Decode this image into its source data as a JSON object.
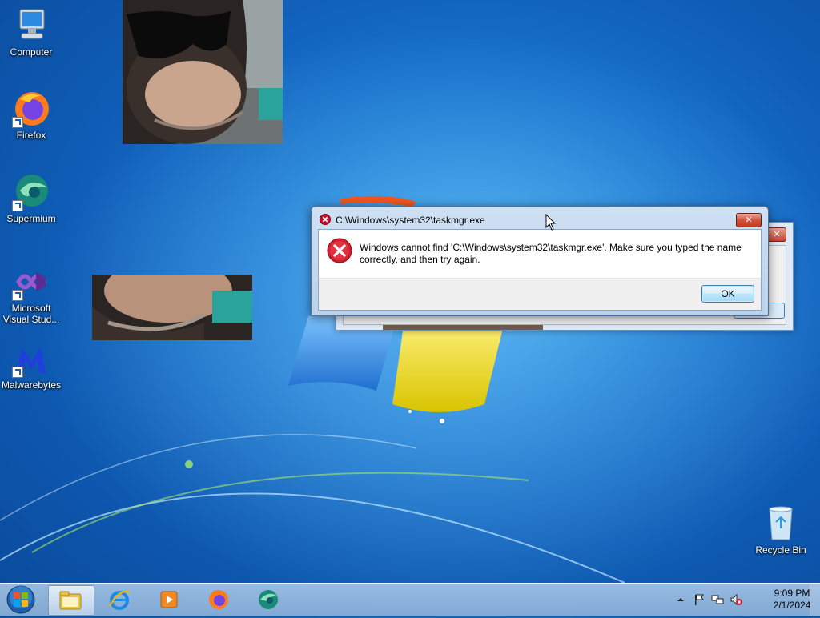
{
  "desktop": {
    "icons": [
      {
        "label": "Computer",
        "icon": "computer-icon"
      },
      {
        "label": "Firefox",
        "icon": "firefox-icon"
      },
      {
        "label": "Supermium",
        "icon": "supermium-icon"
      },
      {
        "label": "Microsoft Visual Stud...",
        "icon": "visual-studio-icon"
      },
      {
        "label": "Malwarebytes",
        "icon": "malwarebytes-icon"
      },
      {
        "label": "Recycle Bin",
        "icon": "recycle-bin-icon"
      }
    ],
    "images": [
      "chimp-photo",
      "chimp-photo-crop"
    ]
  },
  "dialog": {
    "title": "C:\\Windows\\system32\\taskmgr.exe",
    "message": "Windows cannot find 'C:\\Windows\\system32\\taskmgr.exe'. Make sure you typed the name correctly, and then try again.",
    "ok_label": "OK",
    "close_label": "✕",
    "icon": "error-icon"
  },
  "background_window": {
    "close_label": "✕"
  },
  "taskbar": {
    "start": "windows-start-orb",
    "pinned": [
      {
        "name": "explorer-icon",
        "active": true
      },
      {
        "name": "internet-explorer-icon",
        "active": false
      },
      {
        "name": "media-player-icon",
        "active": false
      },
      {
        "name": "firefox-icon",
        "active": false
      },
      {
        "name": "supermium-icon",
        "active": false
      }
    ],
    "tray": {
      "icons": [
        "show-hidden-icons",
        "action-center-flag-icon",
        "network-icon",
        "volume-muted-icon"
      ],
      "time": "9:09 PM",
      "date": "2/1/2024"
    }
  },
  "colors": {
    "error_red": "#c8102e",
    "desktop_blue": "#1a77d0"
  }
}
